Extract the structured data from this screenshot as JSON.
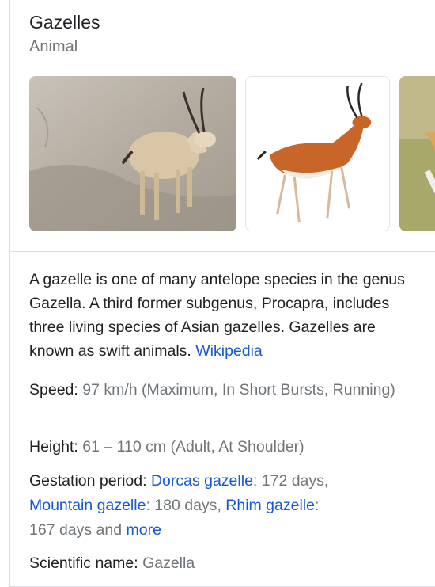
{
  "header": {
    "title": "Gazelles",
    "subtitle": "Animal"
  },
  "description": {
    "text": "A gazelle is one of many antelope species in the genus Gazella. A third former subgenus, Procapra, includes three living species of Asian gazelles. Gazelles are known as swift animals.",
    "source_link": "Wikipedia"
  },
  "facts": {
    "speed": {
      "label": "Speed:",
      "value": "97 km/h (Maximum, In Short Bursts, Running)"
    },
    "height": {
      "label": "Height:",
      "value": "61 – 110 cm (Adult, At Shoulder)"
    },
    "gestation": {
      "label": "Gestation period:",
      "link1": "Dorcas gazelle",
      "val1": ": 172 days,",
      "link2": "Mountain gazelle",
      "val2": ": 180 days,",
      "link3": "Rhim gazelle",
      "val3": ":",
      "val4": "167 days and",
      "more": "more"
    },
    "scientific": {
      "label": "Scientific name:",
      "value": "Gazella"
    }
  },
  "colors": {
    "link": "#1558d6",
    "muted": "#70757a",
    "text": "#202124"
  }
}
